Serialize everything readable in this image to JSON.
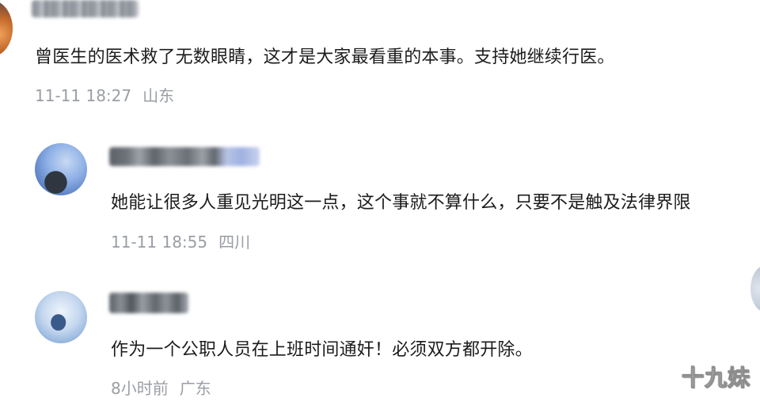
{
  "comments": [
    {
      "text": "曾医生的医术救了无数眼睛，这才是大家最看重的本事。支持她继续行医。",
      "time": "11-11 18:27",
      "location": "山东"
    },
    {
      "text": "她能让很多人重见光明这一点，这个事就不算什么，只要不是触及法律界限",
      "time": "11-11 18:55",
      "location": "四川"
    },
    {
      "text": "作为一个公职人员在上班时间通奸！必须双方都开除。",
      "time": "8小时前",
      "location": "广东"
    }
  ],
  "watermark": "十九妹"
}
